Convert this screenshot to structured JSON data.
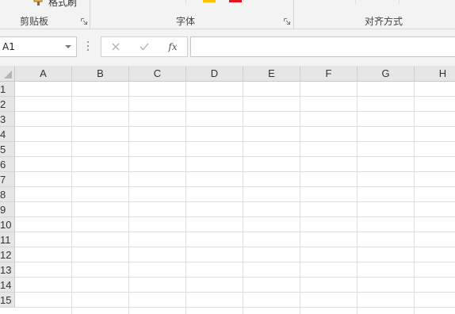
{
  "ribbon": {
    "format_painter_label": "格式刷",
    "groups": [
      {
        "label": "剪贴板"
      },
      {
        "label": "字体"
      },
      {
        "label": "对齐方式"
      }
    ],
    "font_color_accent": "#e81123",
    "highlight_accent": "#ffc000"
  },
  "formula_bar": {
    "name_box_value": "A1",
    "cancel_icon": "x-icon",
    "enter_icon": "check-icon",
    "function_label": "fx",
    "formula_value": ""
  },
  "sheet": {
    "columns": [
      "A",
      "B",
      "C",
      "D",
      "E",
      "F",
      "G",
      "H"
    ],
    "rows": [
      "1",
      "2",
      "3",
      "4",
      "5",
      "6",
      "7",
      "8",
      "9",
      "10",
      "11",
      "12",
      "13",
      "14",
      "15"
    ]
  }
}
